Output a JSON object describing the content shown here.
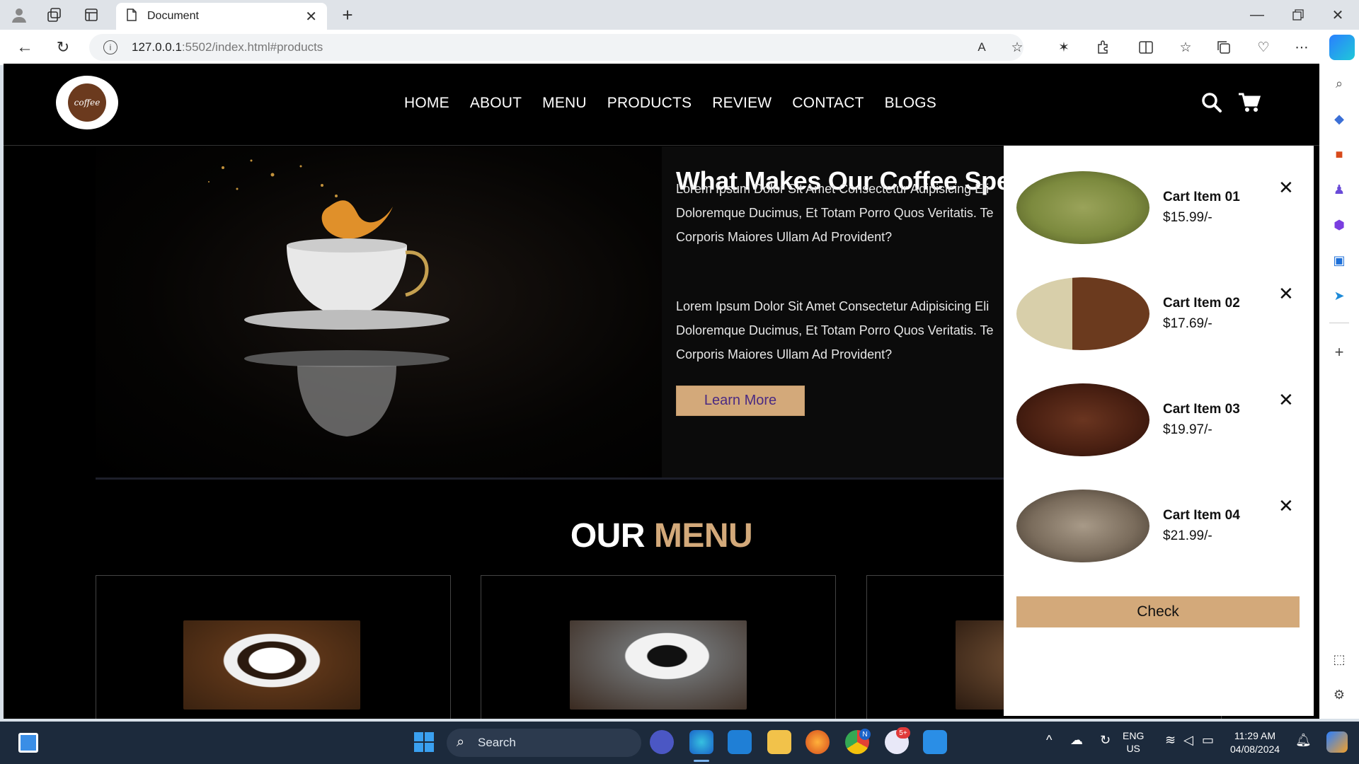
{
  "browser": {
    "tab_title": "Document",
    "url_host": "127.0.0.1",
    "url_rest": ":5502/index.html#products",
    "read_aloud_label": "A"
  },
  "site": {
    "logo_text": "coffee",
    "nav": [
      "HOME",
      "ABOUT",
      "MENU",
      "PRODUCTS",
      "REVIEW",
      "CONTACT",
      "BLOGS"
    ],
    "about": {
      "heading": "What Makes Our Coffee Spe",
      "para1": [
        "Lorem Ipsum Dolor Sit Amet Consectetur Adipisicing Eli",
        "Doloremque Ducimus, Et Totam Porro Quos Veritatis. Te",
        "Corporis Maiores Ullam Ad Provident?"
      ],
      "para2": [
        "Lorem Ipsum Dolor Sit Amet Consectetur Adipisicing Eli",
        "Doloremque Ducimus, Et Totam Porro Quos Veritatis. Te",
        "Corporis Maiores Ullam Ad Provident?"
      ],
      "button": "Learn More"
    },
    "menu_title_a": "OUR",
    "menu_title_b": "MENU",
    "colors": {
      "accent": "#d3a97a",
      "button_text": "#4a2a82"
    }
  },
  "cart": {
    "items": [
      {
        "name": "Cart Item 01",
        "price": "$15.99/-"
      },
      {
        "name": "Cart Item 02",
        "price": "$17.69/-"
      },
      {
        "name": "Cart Item 03",
        "price": "$19.97/-"
      },
      {
        "name": "Cart Item 04",
        "price": "$21.99/-"
      }
    ],
    "remove_glyph": "✕",
    "checkout": "Check"
  },
  "taskbar": {
    "search_placeholder": "Search",
    "lang1": "ENG",
    "lang2": "US",
    "time": "11:29 AM",
    "date": "04/08/2024",
    "zalo_badge": "5+",
    "chrome_badge": "N"
  }
}
